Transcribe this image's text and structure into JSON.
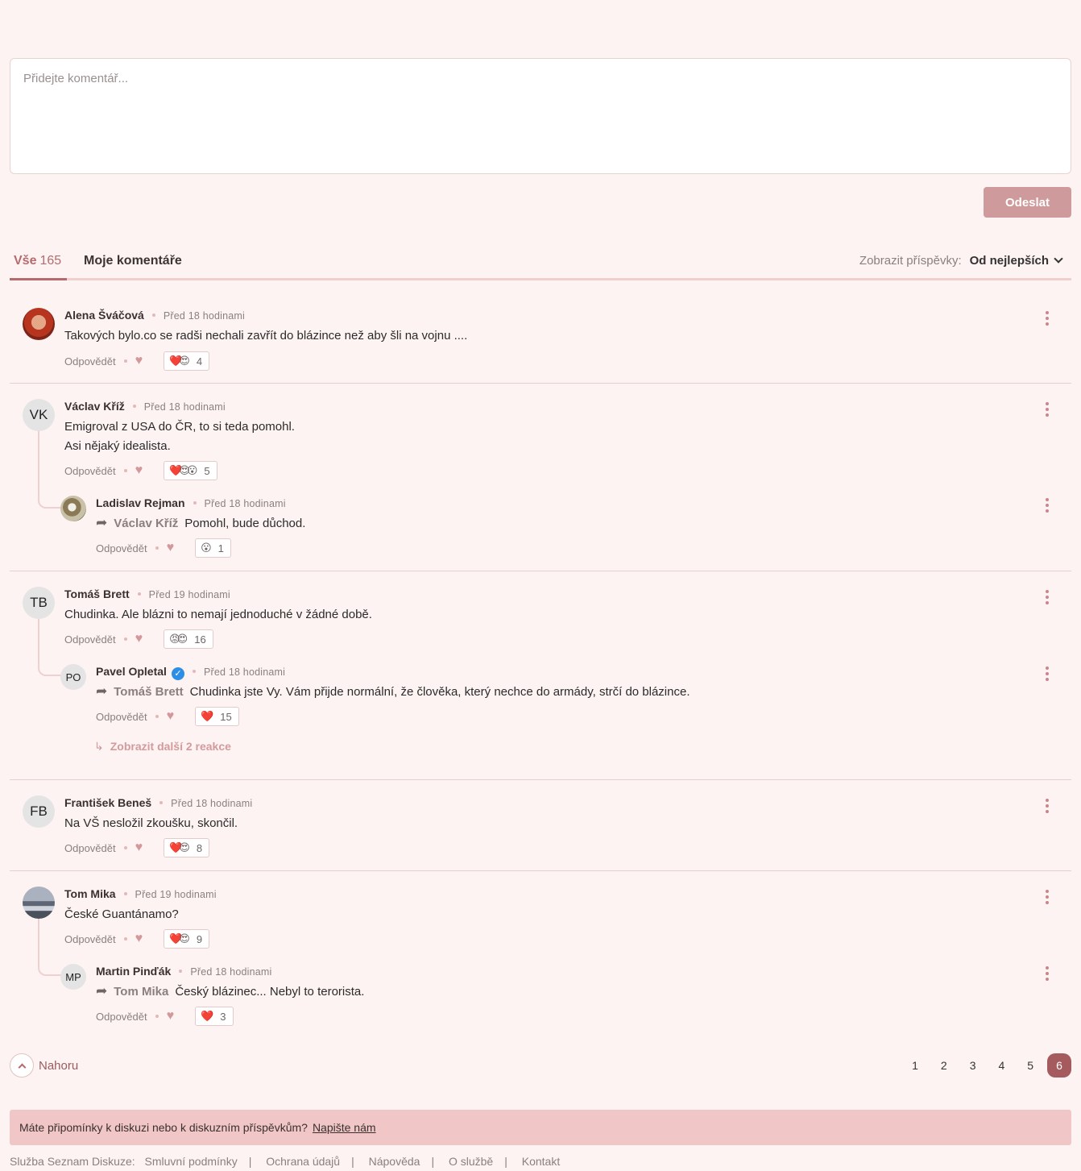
{
  "composer": {
    "placeholder": "Přidejte komentář...",
    "send_label": "Odeslat"
  },
  "tabs": {
    "all_label": "Vše",
    "all_count": "165",
    "mine_label": "Moje komentáře"
  },
  "sort": {
    "label": "Zobrazit příspěvky:",
    "value": "Od nejlepších"
  },
  "labels": {
    "reply": "Odpovědět"
  },
  "threads": [
    {
      "author": "Alena Šváčová",
      "time": "Před 18 hodinami",
      "text": "Takových bylo.co se radši nechali zavřít do blázince než aby šli na vojnu ....",
      "reaction_icons": "❤️😍",
      "reaction_count": "4"
    },
    {
      "author": "Václav Kříž",
      "initials": "VK",
      "time": "Před 18 hodinami",
      "text_lines": [
        "Emigroval z USA do ČR, to si teda pomohl.",
        "Asi nějaký idealista."
      ],
      "reaction_icons": "❤️😍😮",
      "reaction_count": "5",
      "reply": {
        "author": "Ladislav Rejman",
        "time": "Před 18 hodinami",
        "reply_to": "Václav Kříž",
        "text": "Pomohl, bude důchod.",
        "reaction_icons": "😮",
        "reaction_count": "1"
      }
    },
    {
      "author": "Tomáš Brett",
      "initials": "TB",
      "time": "Před 19 hodinami",
      "text": "Chudinka. Ale blázni to nemají jednoduché v žádné době.",
      "reaction_icons": "😡😍",
      "reaction_count": "16",
      "reply": {
        "author": "Pavel Opletal",
        "initials": "PO",
        "time": "Před 18 hodinami",
        "reply_to": "Tomáš Brett",
        "text": "Chudinka jste Vy. Vám přijde normální, že člověka, který nechce do armády, strčí do blázince.",
        "reaction_icons": "❤️",
        "reaction_count": "15"
      },
      "more_replies": "Zobrazit další 2 reakce"
    },
    {
      "author": "František Beneš",
      "initials": "FB",
      "time": "Před 18 hodinami",
      "text": "Na VŠ nesložil zkoušku, skončil.",
      "reaction_icons": "❤️😍",
      "reaction_count": "8"
    },
    {
      "author": "Tom Mika",
      "time": "Před 19 hodinami",
      "text": "České Guantánamo?",
      "reaction_icons": "❤️😍",
      "reaction_count": "9",
      "reply": {
        "author": "Martin Pinďák",
        "initials": "MP",
        "time": "Před 18 hodinami",
        "reply_to": "Tom Mika",
        "text": "Český blázinec... Nebyl to terorista.",
        "reaction_icons": "❤️",
        "reaction_count": "3"
      }
    }
  ],
  "back_to_top": "Nahoru",
  "pages": [
    "1",
    "2",
    "3",
    "4",
    "5",
    "6"
  ],
  "current_page": "6",
  "feedback": {
    "text": "Máte připomínky k diskuzi nebo k diskuzním příspěvkům?",
    "link": "Napište nám"
  },
  "footer": {
    "label": "Služba Seznam Diskuze:",
    "links": [
      "Smluvní podmínky",
      "Ochrana údajů",
      "Nápověda",
      "O službě",
      "Kontakt"
    ]
  },
  "colors": {
    "background": "#fdf3f2",
    "accent": "#b56b6e",
    "send_button": "#cf9a9c",
    "feedback_bar": "#f0c6c6"
  }
}
